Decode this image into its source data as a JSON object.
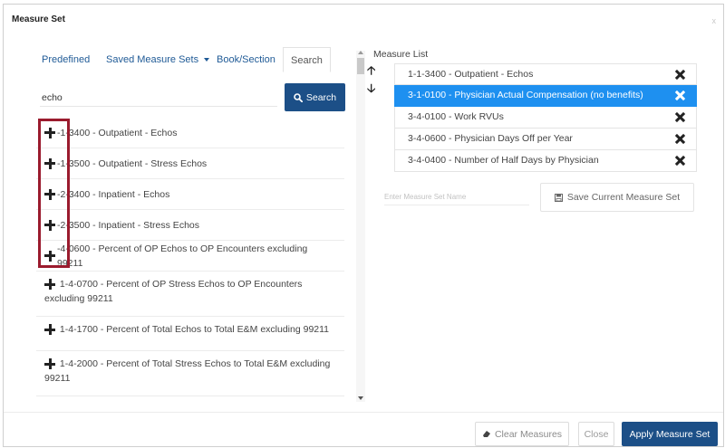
{
  "dialog": {
    "title": "Measure Set",
    "close_glyph": "x"
  },
  "tabs": [
    {
      "label": "Predefined",
      "active": false
    },
    {
      "label": "Saved Measure Sets",
      "active": false,
      "has_dropdown": true
    },
    {
      "label": "Book/Section",
      "active": false
    },
    {
      "label": "Search",
      "active": true
    }
  ],
  "search": {
    "value": "echo",
    "button_label": "Search",
    "button_icon": "search-icon"
  },
  "results": [
    {
      "code": "1-1-3400",
      "name": "Outpatient - Echos",
      "text": "-1-3400 - Outpatient - Echos"
    },
    {
      "code": "1-1-3500",
      "name": "Outpatient - Stress Echos",
      "text": "-1-3500 - Outpatient - Stress Echos"
    },
    {
      "code": "1-2-3400",
      "name": "Inpatient - Echos",
      "text": "-2-3400 - Inpatient - Echos"
    },
    {
      "code": "1-2-3500",
      "name": "Inpatient - Stress Echos",
      "text": "-2-3500 - Inpatient - Stress Echos"
    },
    {
      "code": "1-4-0600",
      "name": "Percent of OP Echos to OP Encounters excluding 99211",
      "text": "-4-0600 - Percent of OP Echos to OP Encounters excluding 99211"
    },
    {
      "code": "1-4-0700",
      "name": "Percent of OP Stress Echos to OP Encounters excluding 99211",
      "text": "1-4-0700 - Percent of OP Stress Echos to OP Encounters excluding 99211"
    },
    {
      "code": "1-4-1700",
      "name": "Percent of Total Echos to Total E&M excluding 99211",
      "text": "1-4-1700 - Percent of Total Echos to Total E&M excluding 99211"
    },
    {
      "code": "1-4-2000",
      "name": "Percent of Total Stress Echos to Total E&M excluding 99211",
      "text": "1-4-2000 - Percent of Total Stress Echos to Total E&M excluding 99211"
    }
  ],
  "measure_list": {
    "label": "Measure List",
    "items": [
      {
        "text": "1-1-3400 - Outpatient - Echos",
        "selected": false
      },
      {
        "text": "3-1-0100 - Physician Actual Compensation (no benefits)",
        "selected": true
      },
      {
        "text": "3-4-0100 - Work RVUs",
        "selected": false
      },
      {
        "text": "3-4-0600 - Physician Days Off per Year",
        "selected": false
      },
      {
        "text": "3-4-0400 - Number of Half Days by Physician",
        "selected": false
      }
    ]
  },
  "save_set": {
    "placeholder": "Enter Measure Set Name",
    "button_label": "Save Current Measure Set",
    "button_icon": "floppy-disk-icon"
  },
  "footer": {
    "clear_label": "Clear Measures",
    "clear_icon": "eraser-icon",
    "close_label": "Close",
    "apply_label": "Apply Measure Set"
  },
  "colors": {
    "primary": "#1c4f87",
    "selected_row": "#1e90f0",
    "highlight_border": "#9b1b2e",
    "link": "#1f5a96"
  }
}
